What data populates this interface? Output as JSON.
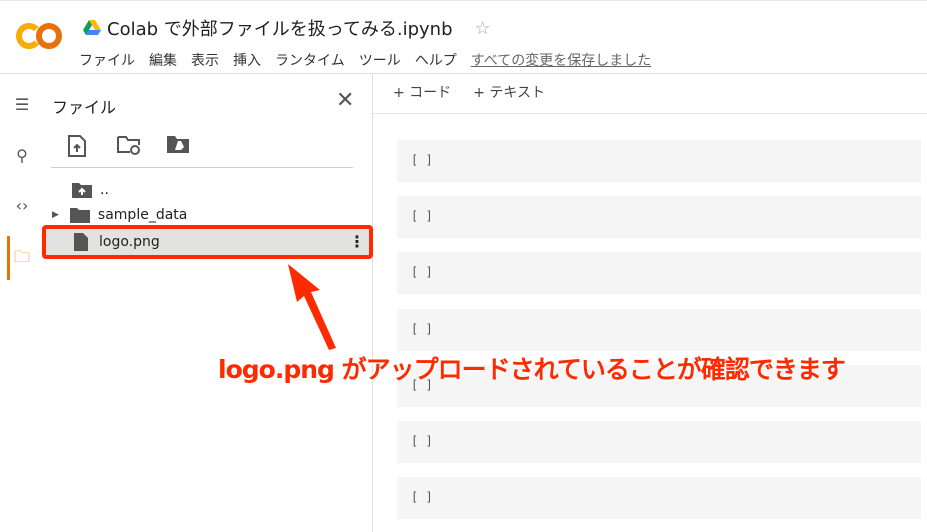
{
  "header": {
    "title": "Colab で外部ファイルを扱ってみる.ipynb",
    "menu": [
      "ファイル",
      "編集",
      "表示",
      "挿入",
      "ランタイム",
      "ツール",
      "ヘルプ"
    ],
    "save_status": "すべての変更を保存しました"
  },
  "rail": {
    "icons": [
      "toc-icon",
      "search-icon",
      "code-icon",
      "folder-icon"
    ]
  },
  "panel": {
    "title": "ファイル",
    "items": [
      {
        "name": "..",
        "type": "parent-folder"
      },
      {
        "name": "sample_data",
        "type": "folder"
      },
      {
        "name": "logo.png",
        "type": "file",
        "selected": true
      }
    ]
  },
  "toolbar": {
    "add_code": "+ コード",
    "add_text": "+ テキスト"
  },
  "cells": [
    "[ ]",
    "[ ]",
    "[ ]",
    "[ ]",
    "[ ]",
    "[ ]",
    "[ ]"
  ],
  "annotation": {
    "text": "logo.png がアップロードされていることが確認できます",
    "color": "#ff2a00"
  },
  "colors": {
    "accent": "#e8710a",
    "highlight": "#ff2a00"
  }
}
